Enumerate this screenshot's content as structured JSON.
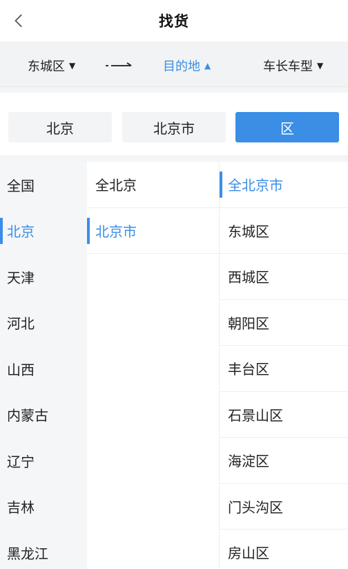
{
  "header": {
    "title": "找货",
    "back_icon": "chevron-left-icon"
  },
  "filters": {
    "origin": "东城区",
    "destination": "目的地",
    "vehicle": "车长车型",
    "arrow_icon": "route-arrow-icon",
    "accent_color": "#3a8ee6"
  },
  "level_tabs": [
    {
      "label": "北京",
      "selected": false
    },
    {
      "label": "北京市",
      "selected": false
    },
    {
      "label": "区",
      "selected": true
    }
  ],
  "provinces": [
    "全国",
    "北京",
    "天津",
    "河北",
    "山西",
    "内蒙古",
    "辽宁",
    "吉林",
    "黑龙江"
  ],
  "selected_province": "北京",
  "cities": [
    "全北京",
    "北京市"
  ],
  "selected_city": "北京市",
  "districts": [
    "全北京市",
    "东城区",
    "西城区",
    "朝阳区",
    "丰台区",
    "石景山区",
    "海淀区",
    "门头沟区",
    "房山区"
  ],
  "selected_district": "全北京市"
}
